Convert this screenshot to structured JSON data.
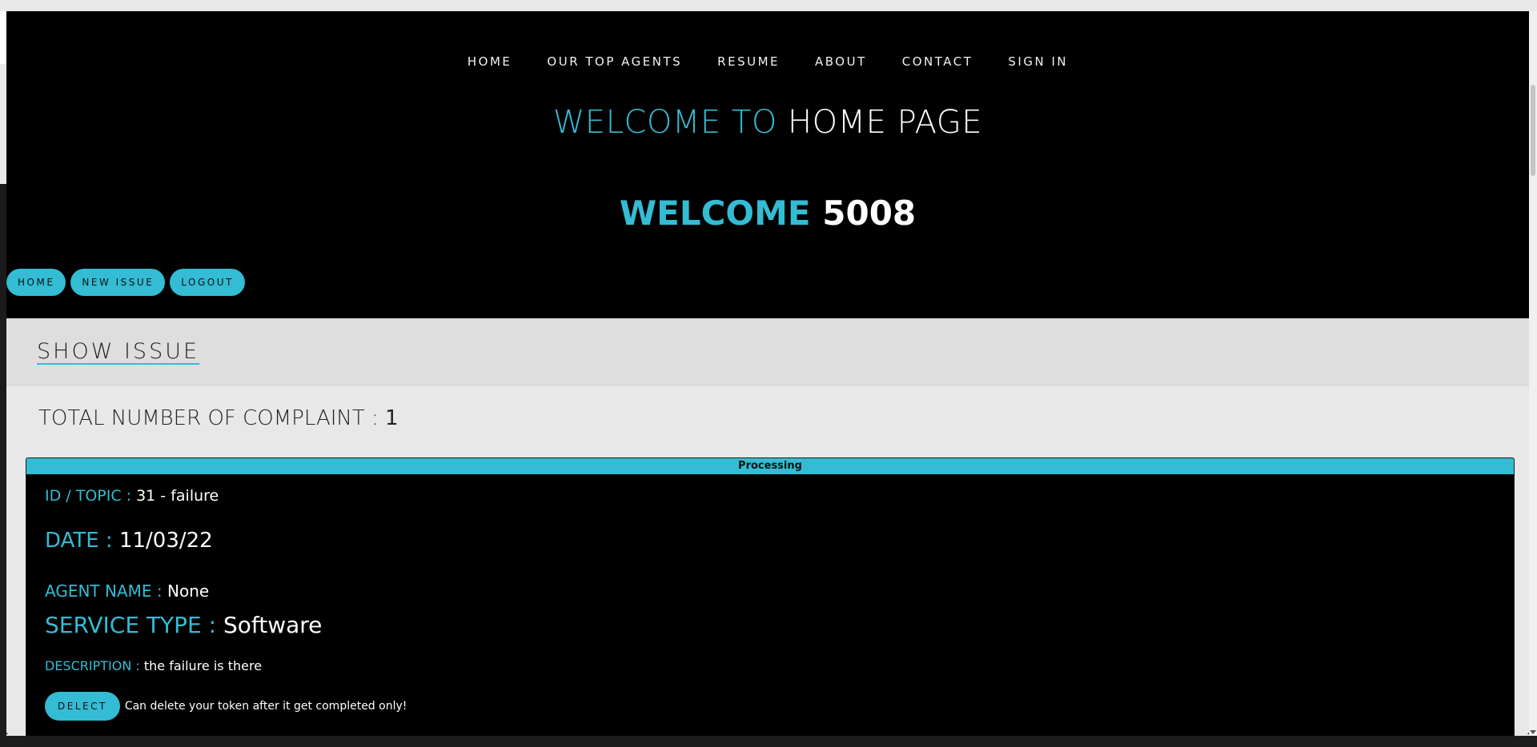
{
  "nav": {
    "items": [
      "HOME",
      "OUR TOP AGENTS",
      "RESUME",
      "ABOUT",
      "CONTACT",
      "SIGN IN"
    ]
  },
  "hero": {
    "welcome_prefix": "WELCOME TO",
    "welcome_page": "HOME PAGE",
    "user_prefix": "WELCOME",
    "user_id": "5008"
  },
  "actions": {
    "home": "HOME",
    "new_issue": "NEW ISSUE",
    "logout": "LOGOUT"
  },
  "panel": {
    "title": "SHOW ISSUE",
    "total_label": "TOTAL NUMBER OF COMPLAINT :",
    "total_value": "1"
  },
  "issue": {
    "status": "Processing",
    "id_topic_label": "ID / TOPIC :",
    "id_topic_value": "31 - failure",
    "date_label": "DATE :",
    "date_value": "11/03/22",
    "agent_label": "AGENT NAME :",
    "agent_value": "None",
    "service_label": "SERVICE TYPE :",
    "service_value": "Software",
    "desc_label": "DESCRIPTION :",
    "desc_value": "the failure is there",
    "delete_label": "DELECT",
    "delete_note": "Can delete your token after it get completed only!"
  },
  "colors": {
    "accent": "#33bcd4",
    "background": "#000000",
    "panel": "#e8e8e8"
  }
}
